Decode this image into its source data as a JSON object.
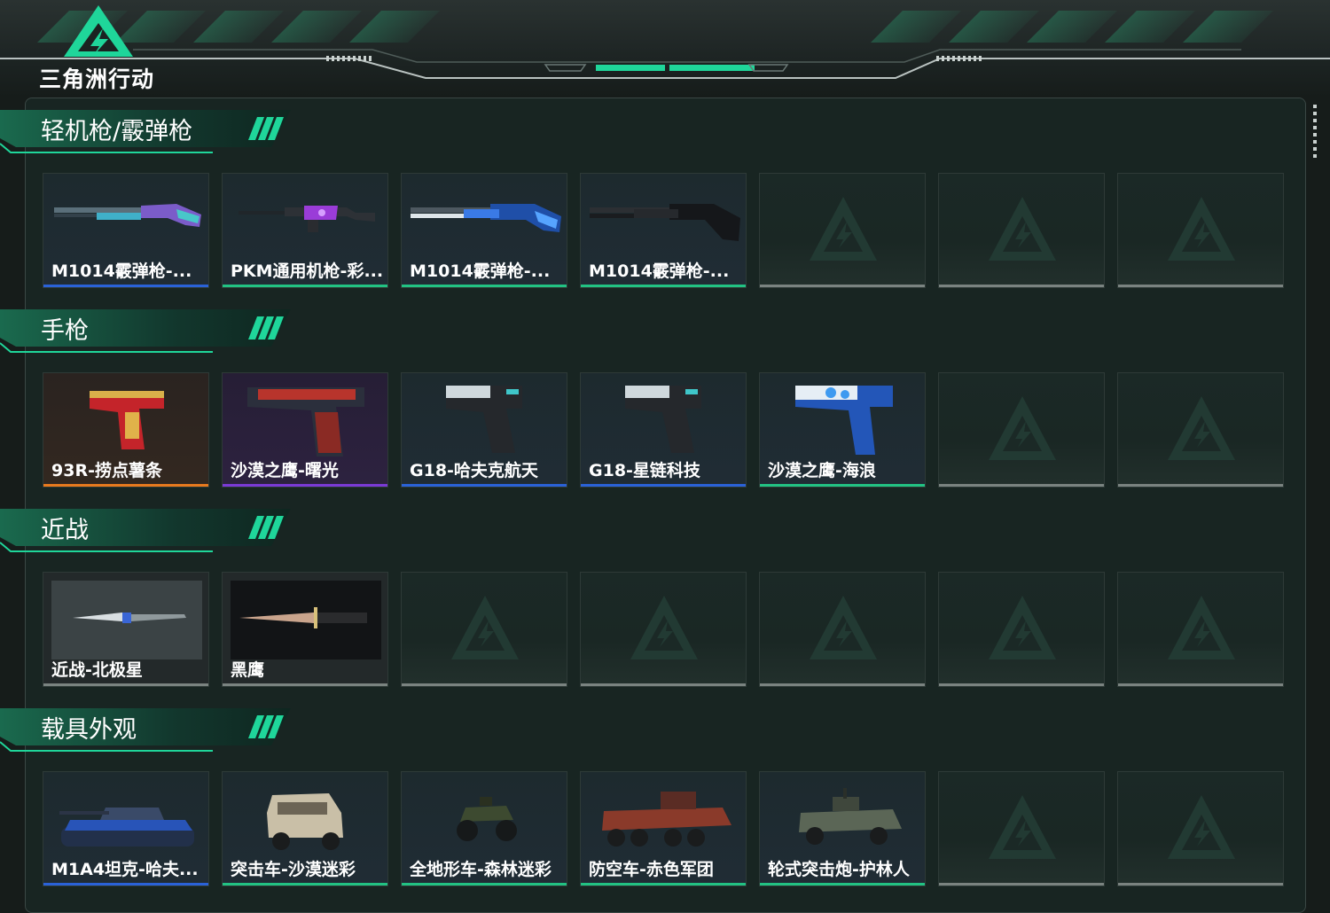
{
  "header": {
    "game_title": "三角洲行动"
  },
  "colors": {
    "accent_green": "#1fd69a",
    "rarity_blue": "#2a62d8",
    "rarity_green": "#22c283",
    "rarity_purple": "#7a3ad6",
    "rarity_orange": "#e87a1e",
    "empty_gray": "#7a8380"
  },
  "sections": [
    {
      "title": "轻机枪/霰弹枪",
      "items": [
        {
          "name": "M1014霰弹枪-...",
          "rarity": "blue",
          "icon": "shotgun-icon"
        },
        {
          "name": "PKM通用机枪-彩...",
          "rarity": "green",
          "icon": "machine-gun-icon"
        },
        {
          "name": "M1014霰弹枪-...",
          "rarity": "green",
          "icon": "shotgun-icon"
        },
        {
          "name": "M1014霰弹枪-...",
          "rarity": "green",
          "icon": "shotgun-icon"
        },
        {
          "name": "",
          "rarity": "empty"
        },
        {
          "name": "",
          "rarity": "empty"
        },
        {
          "name": "",
          "rarity": "empty"
        }
      ]
    },
    {
      "title": "手枪",
      "items": [
        {
          "name": "93R-捞点薯条",
          "rarity": "orange",
          "icon": "pistol-icon"
        },
        {
          "name": "沙漠之鹰-曙光",
          "rarity": "purple",
          "icon": "pistol-icon"
        },
        {
          "name": "G18-哈夫克航天",
          "rarity": "blue",
          "icon": "pistol-icon"
        },
        {
          "name": "G18-星链科技",
          "rarity": "blue",
          "icon": "pistol-icon"
        },
        {
          "name": "沙漠之鹰-海浪",
          "rarity": "green",
          "icon": "pistol-icon"
        },
        {
          "name": "",
          "rarity": "empty"
        },
        {
          "name": "",
          "rarity": "empty"
        }
      ]
    },
    {
      "title": "近战",
      "items": [
        {
          "name": "近战-北极星",
          "rarity": "gray",
          "icon": "knife-icon"
        },
        {
          "name": "黑鹰",
          "rarity": "gray",
          "icon": "knife-icon"
        },
        {
          "name": "",
          "rarity": "empty"
        },
        {
          "name": "",
          "rarity": "empty"
        },
        {
          "name": "",
          "rarity": "empty"
        },
        {
          "name": "",
          "rarity": "empty"
        },
        {
          "name": "",
          "rarity": "empty"
        }
      ]
    },
    {
      "title": "载具外观",
      "items": [
        {
          "name": "M1A4坦克-哈夫...",
          "rarity": "blue",
          "icon": "tank-icon"
        },
        {
          "name": "突击车-沙漠迷彩",
          "rarity": "green",
          "icon": "armored-car-icon"
        },
        {
          "name": "全地形车-森林迷彩",
          "rarity": "green",
          "icon": "atv-icon"
        },
        {
          "name": "防空车-赤色军团",
          "rarity": "green",
          "icon": "apc-icon"
        },
        {
          "name": "轮式突击炮-护林人",
          "rarity": "green",
          "icon": "armored-car-icon"
        },
        {
          "name": "",
          "rarity": "empty"
        },
        {
          "name": "",
          "rarity": "empty"
        }
      ]
    }
  ]
}
